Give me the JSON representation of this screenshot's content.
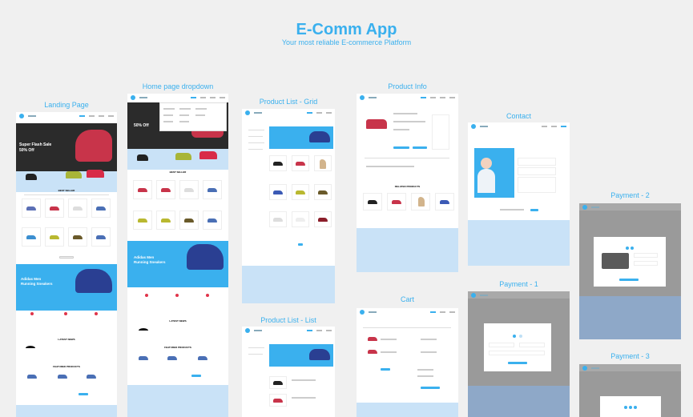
{
  "header": {
    "title": "E-Comm App",
    "subtitle": "Your most reliable  E-commerce Platform"
  },
  "screens": {
    "landing": "Landing Page",
    "dropdown": "Home page dropdown",
    "grid": "Product List - Grid",
    "list": "Product List - List",
    "info": "Product Info",
    "cart": "Cart",
    "contact": "Contact",
    "pay1": "Payment - 1",
    "pay2": "Payment - 2",
    "pay3": "Payment - 3"
  },
  "mock": {
    "hero_sale": "Super Flash Sale",
    "hero_discount": "50% Off",
    "best_seller": "BEST SELLER",
    "banner": "Adidas Men Running Sneakers",
    "latest": "LATEST NEWS",
    "featured": "FEATURED PRODUCTS",
    "related": "RELATED PRODUCTS"
  },
  "colors": {
    "accent": "#3ab0ee",
    "light": "#c9e2f7",
    "dark": "#2b2b2b",
    "red": "#e0344a"
  }
}
